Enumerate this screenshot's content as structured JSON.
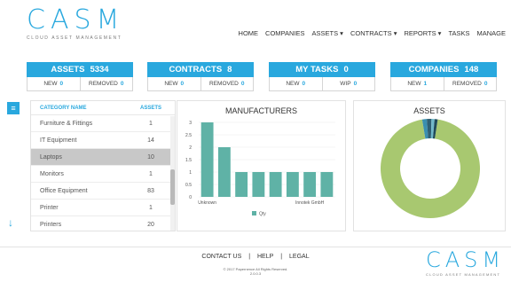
{
  "header": {
    "logo": "CASM",
    "logo_sub": "CLOUD ASSET MANAGEMENT",
    "nav": [
      "HOME",
      "COMPANIES",
      "ASSETS ▾",
      "CONTRACTS ▾",
      "REPORTS ▾",
      "TASKS",
      "MANAGE"
    ]
  },
  "stats": [
    {
      "label": "ASSETS",
      "value": "5334",
      "a_label": "NEW",
      "a_value": "0",
      "b_label": "REMOVED",
      "b_value": "0"
    },
    {
      "label": "CONTRACTS",
      "value": "8",
      "a_label": "NEW",
      "a_value": "0",
      "b_label": "REMOVED",
      "b_value": "0"
    },
    {
      "label": "MY TASKS",
      "value": "0",
      "a_label": "NEW",
      "a_value": "0",
      "b_label": "WIP",
      "b_value": "0"
    },
    {
      "label": "COMPANIES",
      "value": "148",
      "a_label": "NEW",
      "a_value": "1",
      "b_label": "REMOVED",
      "b_value": "0"
    }
  ],
  "categories": {
    "col_name": "CATEGORY NAME",
    "col_assets": "ASSETS",
    "rows": [
      {
        "name": "Furniture & Fittings",
        "assets": "1"
      },
      {
        "name": "IT Equipment",
        "assets": "14"
      },
      {
        "name": "Laptops",
        "assets": "10"
      },
      {
        "name": "Monitors",
        "assets": "1"
      },
      {
        "name": "Office Equipment",
        "assets": "83"
      },
      {
        "name": "Printer",
        "assets": "1"
      },
      {
        "name": "Printers",
        "assets": "20"
      }
    ],
    "selected_index": 2
  },
  "chart_data": [
    {
      "type": "bar",
      "title": "MANUFACTURERS",
      "categories": [
        "Unknown",
        "",
        "",
        "",
        "",
        "",
        "Innotek GmbH",
        ""
      ],
      "series": [
        {
          "name": "Qty",
          "values": [
            3,
            2,
            1,
            1,
            1,
            1,
            1,
            1
          ],
          "color": "#5fb2a6"
        }
      ],
      "ylim": [
        0,
        3
      ],
      "yticks": [
        "0",
        "0.5",
        "1",
        "1.5",
        "2",
        "2.5",
        "3"
      ],
      "grid": true,
      "legend": "bottom"
    },
    {
      "type": "pie",
      "title": "ASSETS",
      "donut": true,
      "values": [
        95,
        1.5,
        1.5,
        1,
        1
      ],
      "colors": [
        "#a8c870",
        "#3a8fb0",
        "#2e5f73",
        "#6fb8c9",
        "#1f4a5a"
      ]
    }
  ],
  "footer": {
    "links": [
      "CONTACT US",
      "HELP",
      "LEGAL"
    ],
    "sep": "|",
    "copyright": "© 2017 Papernence All Rights Reserved.",
    "version": "2.0.0.3"
  },
  "colors": {
    "accent": "#29a8de",
    "bar": "#5fb2a6",
    "donut_main": "#a8c870"
  },
  "icons": {
    "sidebar_toggle": "menu-icon",
    "scroll_down": "arrow-down-icon"
  }
}
